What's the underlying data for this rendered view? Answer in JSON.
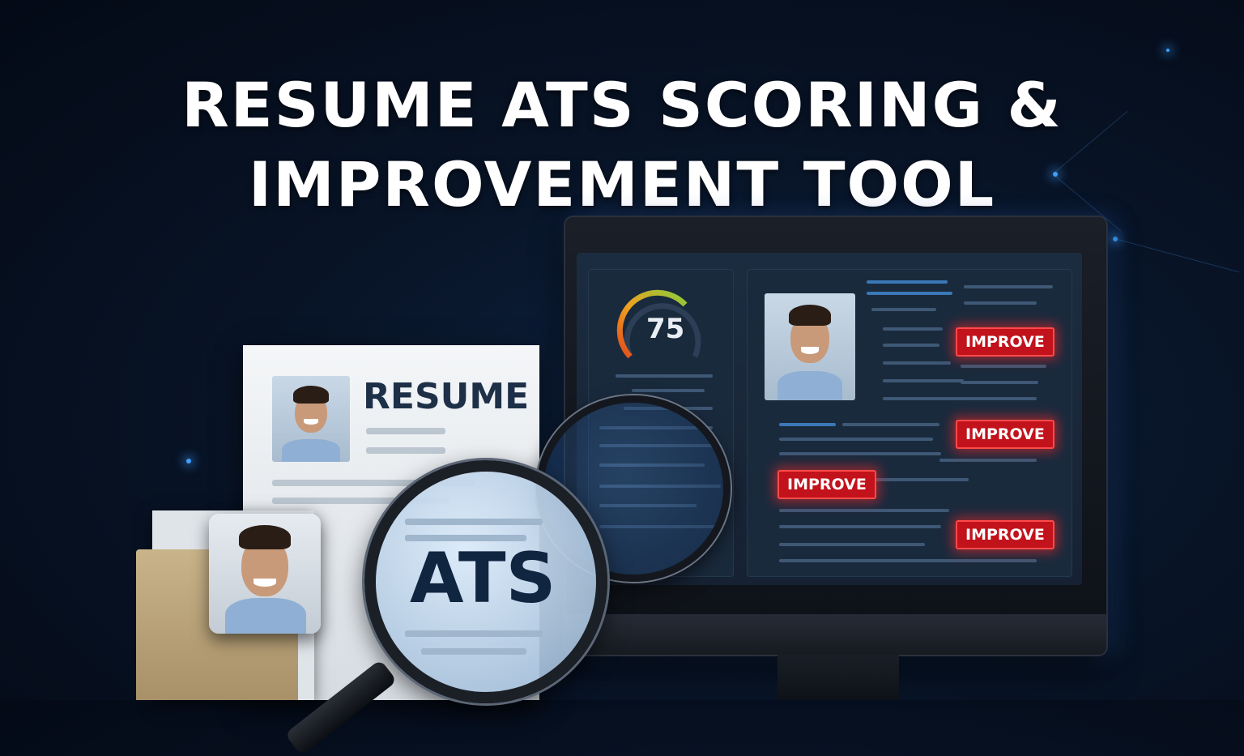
{
  "title": {
    "line1": "RESUME ATS SCORING &",
    "line2": "IMPROVEMENT TOOL"
  },
  "dashboard": {
    "score": "75",
    "improve_buttons": [
      "IMPROVE",
      "IMPROVE",
      "IMPROVE",
      "IMPROVE"
    ]
  },
  "resume": {
    "heading": "RESUME"
  },
  "magnifier": {
    "label": "ATS"
  },
  "colors": {
    "background": "#081427",
    "accent_red": "#c2121b",
    "glow_blue": "#3fa0ff"
  }
}
